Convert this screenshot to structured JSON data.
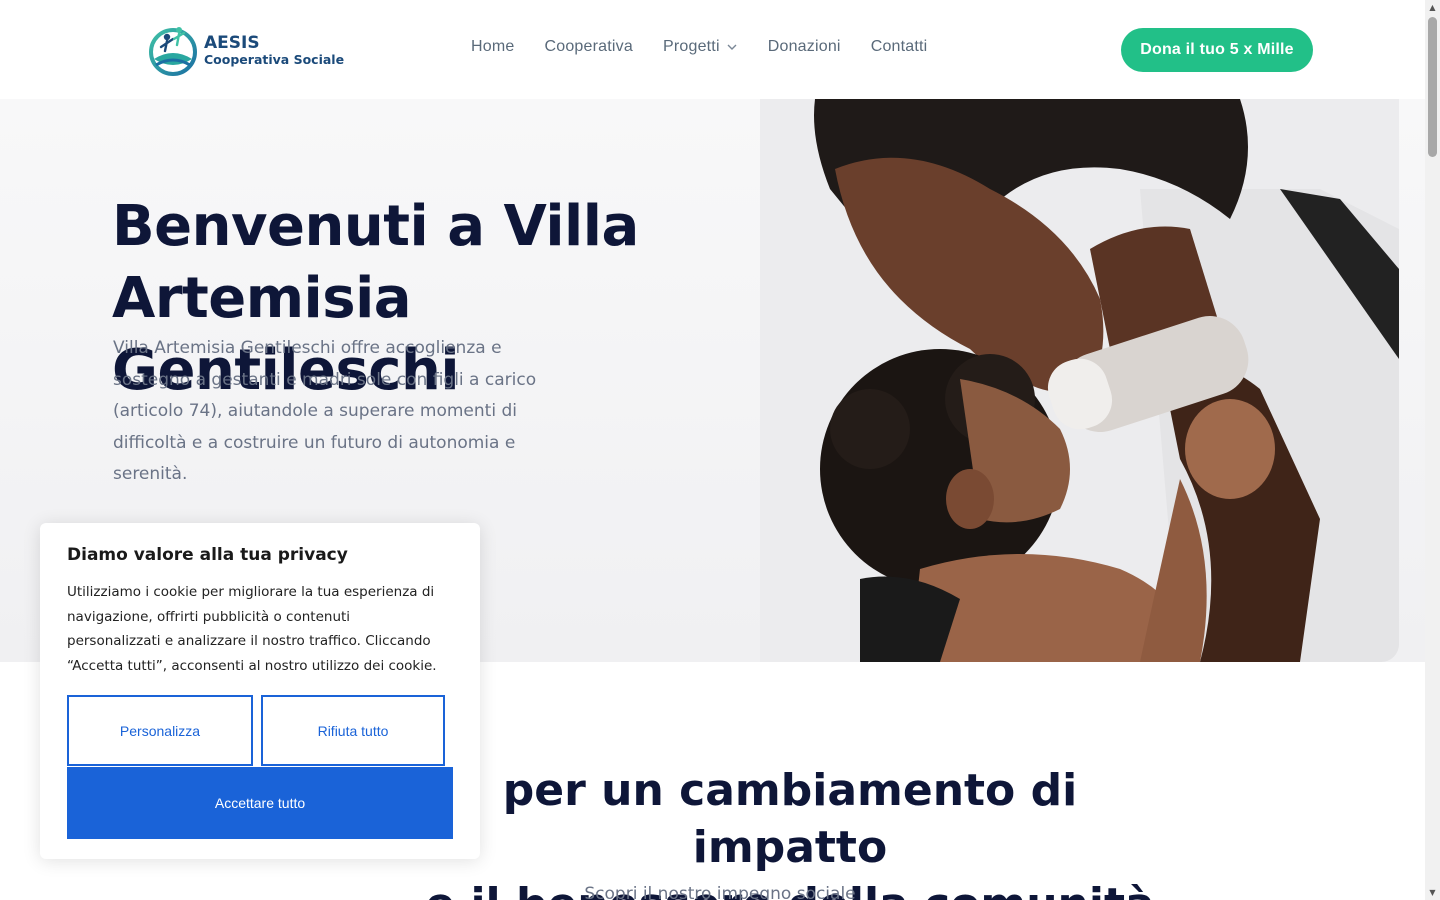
{
  "header": {
    "logo": {
      "name": "AESIS",
      "subtitle": "Cooperativa Sociale"
    },
    "nav": [
      {
        "label": "Home"
      },
      {
        "label": "Cooperativa"
      },
      {
        "label": "Progetti",
        "has_dropdown": true
      },
      {
        "label": "Donazioni"
      },
      {
        "label": "Contatti"
      }
    ],
    "cta_label": "Dona il tuo 5 x Mille"
  },
  "hero": {
    "title_line1": "Benvenuti a Villa",
    "title_line2": "Artemisia Gentileschi",
    "description": "Villa Artemisia Gentileschi offre accoglienza e sostegno a gestanti e madri sole con figli a carico (articolo 74), aiutandole a superare momenti di difficoltà e a costruire un futuro di autonomia e serenità."
  },
  "section": {
    "title_line1": "per un cambiamento di impatto",
    "title_line2": "e il benessere della comunità",
    "subtitle": "Scopri il nostro impegno sociale"
  },
  "cookie_banner": {
    "title": "Diamo valore alla tua privacy",
    "text": "Utilizziamo i cookie per migliorare la tua esperienza di navigazione, offrirti pubblicità o contenuti personalizzati e analizzare il nostro traffico. Cliccando “Accetta tutti”, acconsenti al nostro utilizzo dei cookie.",
    "customize_label": "Personalizza",
    "reject_label": "Rifiuta tutto",
    "accept_label": "Accettare tutto"
  },
  "colors": {
    "accent_green": "#22c088",
    "cookie_blue": "#1a63d8",
    "heading_navy": "#0e1638",
    "logo_blue": "#1b4a7a"
  },
  "icons": [
    "logo-mark-icon",
    "chevron-down-icon",
    "scroll-up-arrow-icon",
    "scroll-down-arrow-icon"
  ]
}
